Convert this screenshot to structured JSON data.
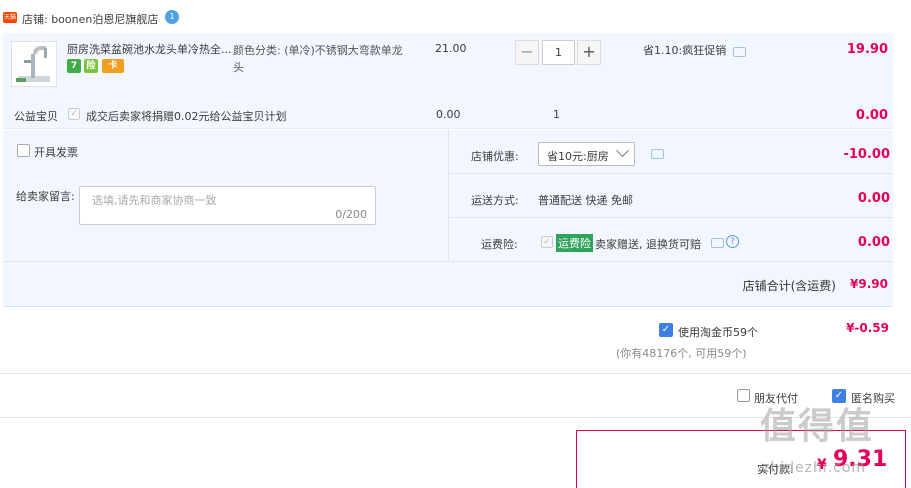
{
  "shop": {
    "badge": "天猫",
    "label": "店铺: boonen泊恩尼旗舰店",
    "chat_badge": "1"
  },
  "item": {
    "title": "厨房洗菜盆碗池水龙头单冷热全...",
    "sku": "颜色分类: (单冷)不锈钢大弯款单龙头",
    "unit_price": "21.00",
    "qty": "1",
    "qty_minus": "−",
    "qty_plus": "+",
    "promo": "省1.10:疯狂促销",
    "total": "19.90",
    "service_icons": [
      "7",
      "险",
      "卡"
    ]
  },
  "charity": {
    "label": "公益宝贝",
    "check": "✓",
    "text": "成交后卖家将捐赠0.02元给公益宝贝计划",
    "price": "0.00",
    "qty": "1",
    "total": "0.00"
  },
  "options": {
    "invoice_label": "开具发票",
    "memo_label": "给卖家留言:",
    "memo_placeholder": "选填,请先和商家协商一致",
    "memo_count": "0/200",
    "coupon_label": "店铺优惠:",
    "coupon_value": "省10元:厨房",
    "coupon_amount": "-10.00",
    "shipping_label": "运送方式:",
    "shipping_value": "普通配送 快递 免邮",
    "shipping_amount": "0.00",
    "insurance_label": "运费险:",
    "insurance_check": "✓",
    "insurance_badge": "运费险",
    "insurance_text": "卖家赠送, 退换货可赔",
    "insurance_help": "?",
    "insurance_amount": "0.00",
    "subtotal_label": "店铺合计(含运费)",
    "subtotal_value": "¥9.90"
  },
  "coins": {
    "check": "✓",
    "label": "使用淘金币59个",
    "value": "¥-0.59",
    "note": "(你有48176个, 可用59个)"
  },
  "extras": {
    "friend_label": "朋友代付",
    "anon_check": "✓",
    "anon_label": "匿名购买"
  },
  "pay": {
    "label": "实付款:",
    "currency": "¥",
    "amount": "9.31"
  },
  "watermark": {
    "main": "值得值",
    "sub": "zhidezhi.com"
  }
}
